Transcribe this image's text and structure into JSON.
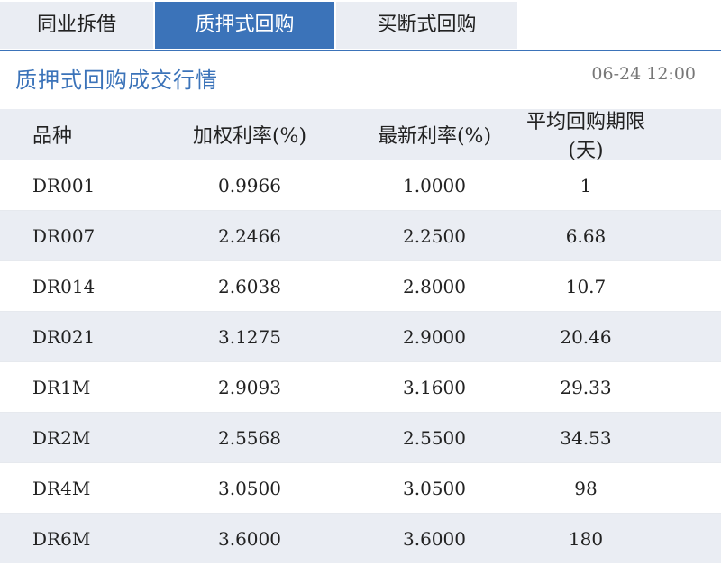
{
  "tabs": [
    {
      "label": "同业拆借",
      "active": false
    },
    {
      "label": "质押式回购",
      "active": true
    },
    {
      "label": "买断式回购",
      "active": false
    }
  ],
  "panel": {
    "title": "质押式回购成交行情",
    "timestamp": "06-24 12:00"
  },
  "table": {
    "headers": [
      "品种",
      "加权利率(%)",
      "最新利率(%)",
      "平均回购期限(天)"
    ],
    "rows": [
      [
        "DR001",
        "0.9966",
        "1.0000",
        "1"
      ],
      [
        "DR007",
        "2.2466",
        "2.2500",
        "6.68"
      ],
      [
        "DR014",
        "2.6038",
        "2.8000",
        "10.7"
      ],
      [
        "DR021",
        "3.1275",
        "2.9000",
        "20.46"
      ],
      [
        "DR1M",
        "2.9093",
        "3.1600",
        "29.33"
      ],
      [
        "DR2M",
        "2.5568",
        "2.5500",
        "34.53"
      ],
      [
        "DR4M",
        "3.0500",
        "3.0500",
        "98"
      ],
      [
        "DR6M",
        "3.6000",
        "3.6000",
        "180"
      ]
    ]
  },
  "colors": {
    "accent": "#3b73b9",
    "header_bg": "#eaedf3",
    "muted_text": "#777777"
  }
}
